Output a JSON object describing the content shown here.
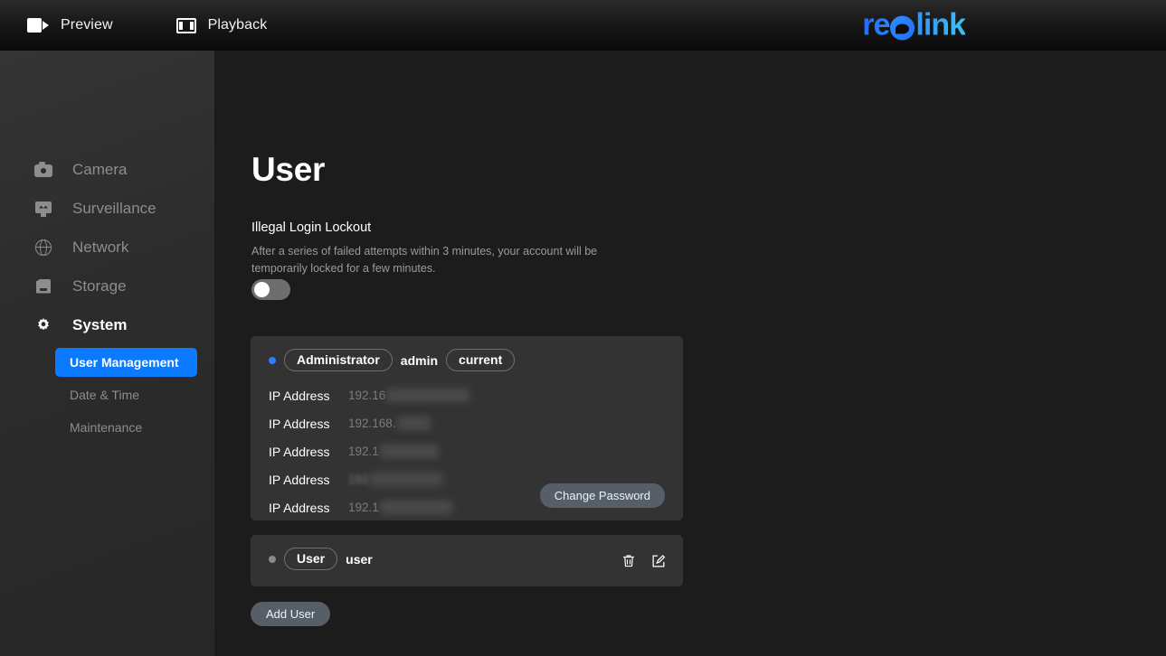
{
  "topbar": {
    "tabs": [
      {
        "label": "Preview",
        "icon": "videocam-icon"
      },
      {
        "label": "Playback",
        "icon": "film-icon"
      }
    ],
    "logo": {
      "prefix": "re",
      "suffix": "link",
      "full": "reolink"
    }
  },
  "sidebar": {
    "items": [
      {
        "label": "Camera",
        "icon": "camera-icon",
        "active": false
      },
      {
        "label": "Surveillance",
        "icon": "monitor-icon",
        "active": false
      },
      {
        "label": "Network",
        "icon": "globe-icon",
        "active": false
      },
      {
        "label": "Storage",
        "icon": "sd-card-icon",
        "active": false
      },
      {
        "label": "System",
        "icon": "gear-icon",
        "active": true
      }
    ],
    "subitems": [
      {
        "label": "User Management",
        "active": true
      },
      {
        "label": "Date & Time",
        "active": false
      },
      {
        "label": "Maintenance",
        "active": false
      }
    ]
  },
  "main": {
    "title": "User",
    "lockout": {
      "title": "Illegal Login Lockout",
      "description": "After a series of failed attempts within 3 minutes, your account will be temporarily locked for a few minutes.",
      "enabled": false
    },
    "admin_card": {
      "role_badge": "Administrator",
      "username": "admin",
      "status_badge": "current",
      "status": "online",
      "ip_label": "IP Address",
      "ip_rows": [
        {
          "label": "IP Address",
          "visible": "192.16",
          "redacted": true
        },
        {
          "label": "IP Address",
          "visible": "192.168.",
          "redacted": true
        },
        {
          "label": "IP Address",
          "visible": "192.1",
          "redacted": true
        },
        {
          "label": "IP Address",
          "visible": "192",
          "redacted": true
        },
        {
          "label": "IP Address",
          "visible": "192.1",
          "redacted": true
        }
      ],
      "change_password_label": "Change Password"
    },
    "user_card": {
      "role_badge": "User",
      "username": "user",
      "status": "offline",
      "delete_icon": "trash-icon",
      "edit_icon": "edit-icon"
    },
    "add_user_label": "Add User"
  },
  "colors": {
    "accent_blue": "#0b7aff",
    "status_online": "#2a7fff",
    "status_offline": "#8a8a8a",
    "button_gray": "#565e68",
    "card_bg": "#333333",
    "page_bg": "#1c1c1c",
    "sidebar_bg": "#2c2c2c"
  }
}
